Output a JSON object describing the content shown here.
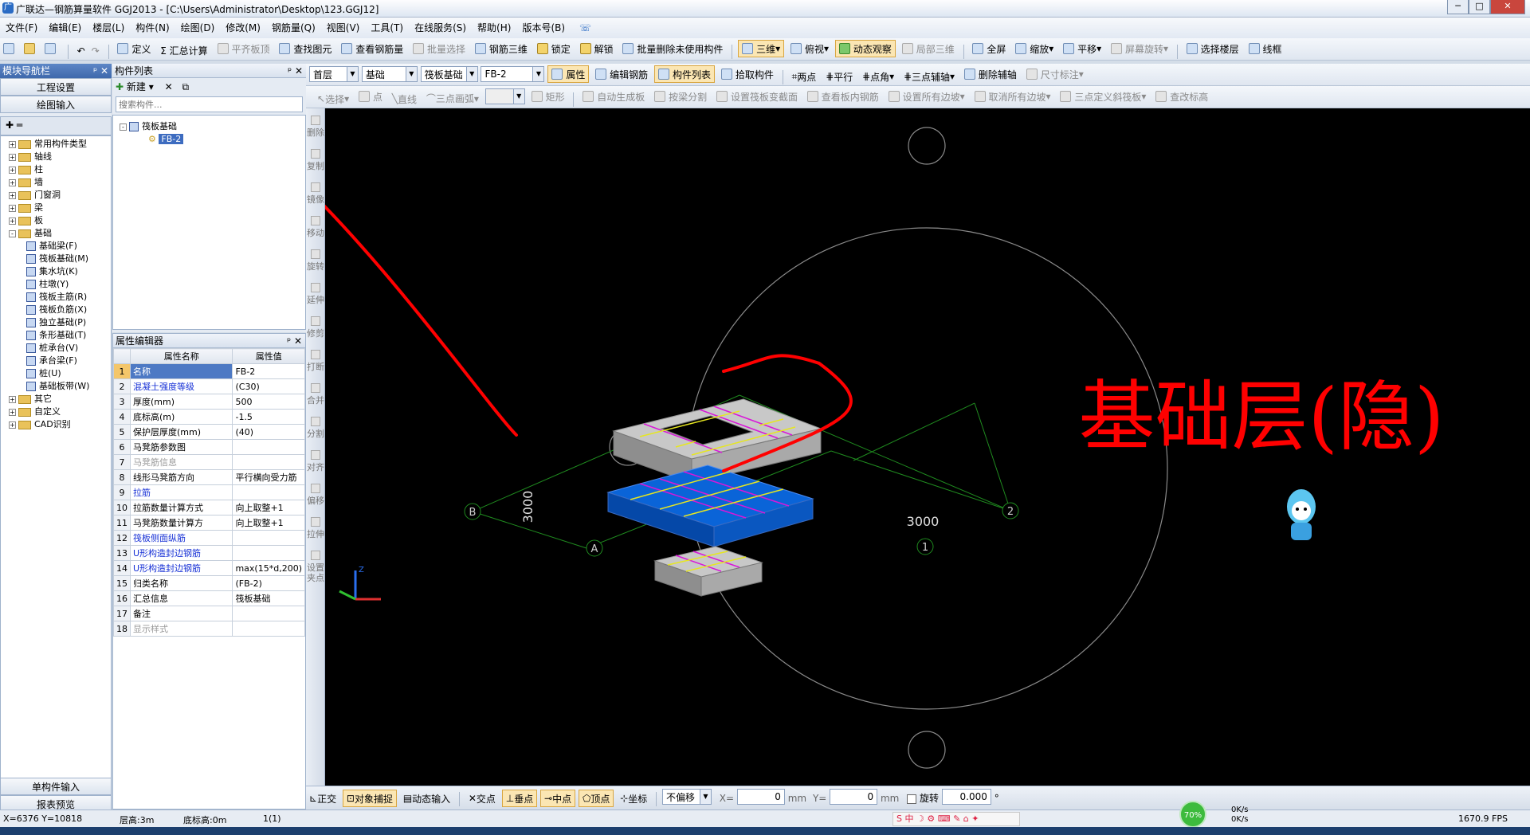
{
  "window": {
    "title": "广联达—钢筋算量软件 GGJ2013 - [C:\\Users\\Administrator\\Desktop\\123.GGJ12]",
    "buttons": [
      "─",
      "□",
      "✕"
    ]
  },
  "menu": [
    "文件(F)",
    "编辑(E)",
    "楼层(L)",
    "构件(N)",
    "绘图(D)",
    "修改(M)",
    "钢筋量(Q)",
    "视图(V)",
    "工具(T)",
    "在线服务(S)",
    "帮助(H)",
    "版本号(B)"
  ],
  "toolbar1": {
    "items": [
      "定义",
      "Σ 汇总计算",
      "平齐板顶",
      "查找图元",
      "查看钢筋量",
      "批量选择",
      "钢筋三维",
      "锁定",
      "解锁",
      "批量删除未使用构件"
    ],
    "view_items": [
      "三维",
      "俯视",
      "动态观察",
      "局部三维",
      "全屏",
      "缩放",
      "平移",
      "屏幕旋转",
      "选择楼层",
      "线框"
    ]
  },
  "toolbar2": {
    "floor": "首层",
    "floor_sub": "基础",
    "category": "筏板基础",
    "component": "FB-2",
    "items": [
      "属性",
      "编辑钢筋",
      "构件列表",
      "拾取构件",
      "两点",
      "平行",
      "点角",
      "三点辅轴",
      "删除辅轴",
      "尺寸标注"
    ]
  },
  "toolbar3": {
    "items": [
      "选择",
      "点",
      "直线",
      "三点画弧",
      "矩形",
      "自动生成板",
      "按梁分割",
      "设置筏板变截面",
      "查看板内钢筋",
      "设置所有边坡",
      "取消所有边坡",
      "三点定义斜筏板",
      "查改标高"
    ]
  },
  "nav": {
    "title": "模块导航栏",
    "buttons": [
      "工程设置",
      "绘图输入"
    ],
    "bottom_buttons": [
      "单构件输入",
      "报表预览"
    ],
    "tree": [
      {
        "label": "常用构件类型",
        "level": 0,
        "exp": "+"
      },
      {
        "label": "轴线",
        "level": 0,
        "exp": "+"
      },
      {
        "label": "柱",
        "level": 0,
        "exp": "+"
      },
      {
        "label": "墙",
        "level": 0,
        "exp": "+"
      },
      {
        "label": "门窗洞",
        "level": 0,
        "exp": "+"
      },
      {
        "label": "梁",
        "level": 0,
        "exp": "+"
      },
      {
        "label": "板",
        "level": 0,
        "exp": "+"
      },
      {
        "label": "基础",
        "level": 0,
        "exp": "-"
      },
      {
        "label": "基础梁(F)",
        "level": 1
      },
      {
        "label": "筏板基础(M)",
        "level": 1
      },
      {
        "label": "集水坑(K)",
        "level": 1
      },
      {
        "label": "柱墩(Y)",
        "level": 1
      },
      {
        "label": "筏板主筋(R)",
        "level": 1
      },
      {
        "label": "筏板负筋(X)",
        "level": 1
      },
      {
        "label": "独立基础(P)",
        "level": 1
      },
      {
        "label": "条形基础(T)",
        "level": 1
      },
      {
        "label": "桩承台(V)",
        "level": 1
      },
      {
        "label": "承台梁(F)",
        "level": 1
      },
      {
        "label": "桩(U)",
        "level": 1
      },
      {
        "label": "基础板带(W)",
        "level": 1
      },
      {
        "label": "其它",
        "level": 0,
        "exp": "+"
      },
      {
        "label": "自定义",
        "level": 0,
        "exp": "+"
      },
      {
        "label": "CAD识别",
        "level": 0,
        "exp": "+"
      }
    ]
  },
  "component_list": {
    "title": "构件列表",
    "new_label": "新建",
    "search_placeholder": "搜索构件...",
    "root": "筏板基础",
    "child": "FB-2"
  },
  "props": {
    "title": "属性编辑器",
    "col_name": "属性名称",
    "col_value": "属性值",
    "rows": [
      {
        "n": "1",
        "name": "名称",
        "value": "FB-2",
        "style": "sel"
      },
      {
        "n": "2",
        "name": "混凝土强度等级",
        "value": "(C30)",
        "style": "blue"
      },
      {
        "n": "3",
        "name": "厚度(mm)",
        "value": "500",
        "style": ""
      },
      {
        "n": "4",
        "name": "底标高(m)",
        "value": "-1.5",
        "style": ""
      },
      {
        "n": "5",
        "name": "保护层厚度(mm)",
        "value": "(40)",
        "style": ""
      },
      {
        "n": "6",
        "name": "马凳筋参数图",
        "value": "",
        "style": ""
      },
      {
        "n": "7",
        "name": "马凳筋信息",
        "value": "",
        "style": "gray"
      },
      {
        "n": "8",
        "name": "线形马凳筋方向",
        "value": "平行横向受力筋",
        "style": ""
      },
      {
        "n": "9",
        "name": "拉筋",
        "value": "",
        "style": "blue"
      },
      {
        "n": "10",
        "name": "拉筋数量计算方式",
        "value": "向上取整+1",
        "style": ""
      },
      {
        "n": "11",
        "name": "马凳筋数量计算方",
        "value": "向上取整+1",
        "style": ""
      },
      {
        "n": "12",
        "name": "筏板侧面纵筋",
        "value": "",
        "style": "blue"
      },
      {
        "n": "13",
        "name": "U形构造封边钢筋",
        "value": "",
        "style": "blue"
      },
      {
        "n": "14",
        "name": "U形构造封边钢筋",
        "value": "max(15*d,200)",
        "style": "blue"
      },
      {
        "n": "15",
        "name": "归类名称",
        "value": "(FB-2)",
        "style": ""
      },
      {
        "n": "16",
        "name": "汇总信息",
        "value": "筏板基础",
        "style": ""
      },
      {
        "n": "17",
        "name": "备注",
        "value": "",
        "style": ""
      },
      {
        "n": "18",
        "name": "显示样式",
        "value": "",
        "style": "gray"
      }
    ]
  },
  "side_tools": [
    "删除",
    "复制",
    "镜像",
    "移动",
    "旋转",
    "延伸",
    "修剪",
    "打断",
    "合并",
    "分割",
    "对齐",
    "偏移",
    "拉伸",
    "设置夹点"
  ],
  "viewport": {
    "axis_labels": [
      "B",
      "A",
      "1",
      "2"
    ],
    "dims": [
      "3000",
      "3000"
    ],
    "annotation": "基础层(隐)"
  },
  "snapbar": {
    "items": [
      "正交",
      "对象捕捉",
      "动态输入",
      "交点",
      "垂点",
      "中点",
      "顶点",
      "坐标"
    ],
    "offset_mode": "不偏移",
    "x_label": "X=",
    "x_value": "0",
    "y_label": "Y=",
    "y_value": "0",
    "unit": "mm",
    "rotate_label": "旋转",
    "rotate_value": "0.000",
    "degree": "°"
  },
  "status": {
    "coords": "X=6376  Y=10818",
    "floor_height": "层高:3m",
    "bottom_elev": "底标高:0m",
    "count": "1(1)",
    "net_percent": "70%",
    "net_up": "0K/s",
    "net_down": "0K/s",
    "fps": "1670.9 FPS"
  }
}
